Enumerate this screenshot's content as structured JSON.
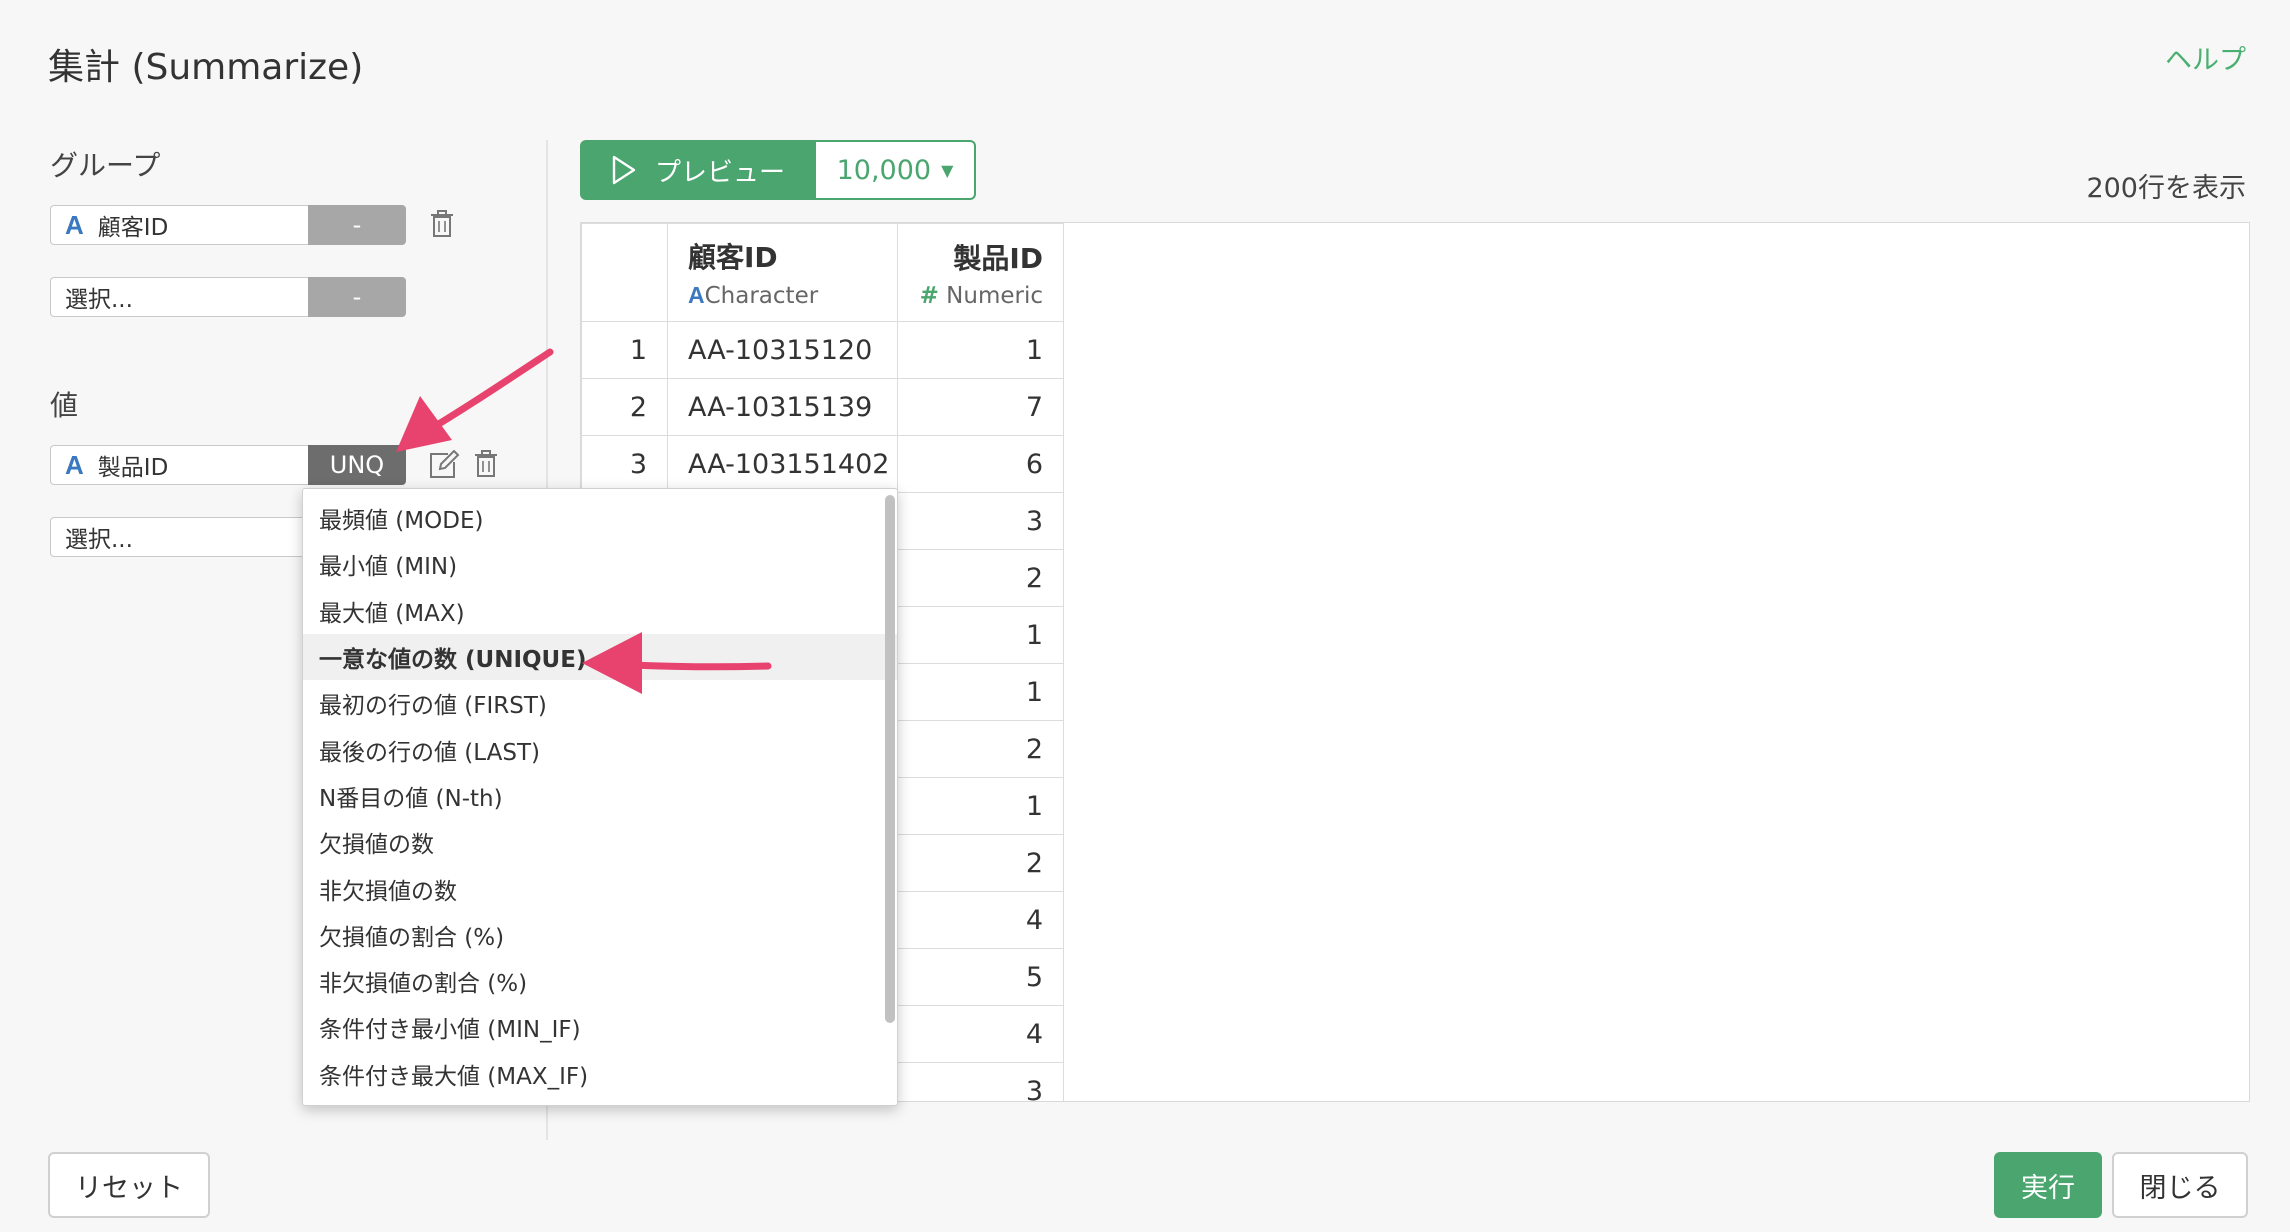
{
  "dialog": {
    "title": "集計 (Summarize)",
    "help": "ヘルプ"
  },
  "group_section": {
    "label": "グループ",
    "field1": {
      "type_icon": "A",
      "name": "顧客ID",
      "button": "-"
    },
    "field2": {
      "placeholder": "選択...",
      "button": "-"
    }
  },
  "value_section": {
    "label": "値",
    "field1": {
      "type_icon": "A",
      "name": "製品ID",
      "button": "UNQ"
    },
    "field2": {
      "placeholder": "選択..."
    }
  },
  "preview": {
    "label": "プレビュー",
    "count": "10,000",
    "rows_info": "200行を表示"
  },
  "table": {
    "columns": [
      {
        "name": "顧客ID",
        "type_icon": "A",
        "type": "Character"
      },
      {
        "name": "製品ID",
        "type_icon": "#",
        "type": "Numeric"
      }
    ],
    "rows": [
      {
        "idx": "1",
        "customer": "AA-10315120",
        "product": "1"
      },
      {
        "idx": "2",
        "customer": "AA-10315139",
        "product": "7"
      },
      {
        "idx": "3",
        "customer": "AA-103151402",
        "product": "6"
      },
      {
        "idx": "",
        "customer": "",
        "product": "3"
      },
      {
        "idx": "",
        "customer": "",
        "product": "2"
      },
      {
        "idx": "",
        "customer": "",
        "product": "1"
      },
      {
        "idx": "",
        "customer": "",
        "product": "1"
      },
      {
        "idx": "",
        "customer": "",
        "product": "2"
      },
      {
        "idx": "",
        "customer": "",
        "product": "1"
      },
      {
        "idx": "",
        "customer": "",
        "product": "2"
      },
      {
        "idx": "",
        "customer": "",
        "product": "4"
      },
      {
        "idx": "",
        "customer": "",
        "product": "5"
      },
      {
        "idx": "",
        "customer": "",
        "product": "4"
      },
      {
        "idx": "",
        "customer": "",
        "product": "3"
      }
    ]
  },
  "dropdown": {
    "items": [
      "最頻値 (MODE)",
      "最小値 (MIN)",
      "最大値 (MAX)",
      "一意な値の数 (UNIQUE)",
      "最初の行の値 (FIRST)",
      "最後の行の値 (LAST)",
      "N番目の値 (N-th)",
      "欠損値の数",
      "非欠損値の数",
      "欠損値の割合 (%)",
      "非欠損値の割合 (%)",
      "条件付き最小値 (MIN_IF)",
      "条件付き最大値 (MAX_IF)"
    ],
    "selected": "一意な値の数 (UNIQUE)"
  },
  "footer": {
    "reset": "リセット",
    "run": "実行",
    "close": "閉じる"
  },
  "colors": {
    "accent": "#4aa56f",
    "arrow": "#e8436e",
    "type_character": "#3a78c0"
  }
}
